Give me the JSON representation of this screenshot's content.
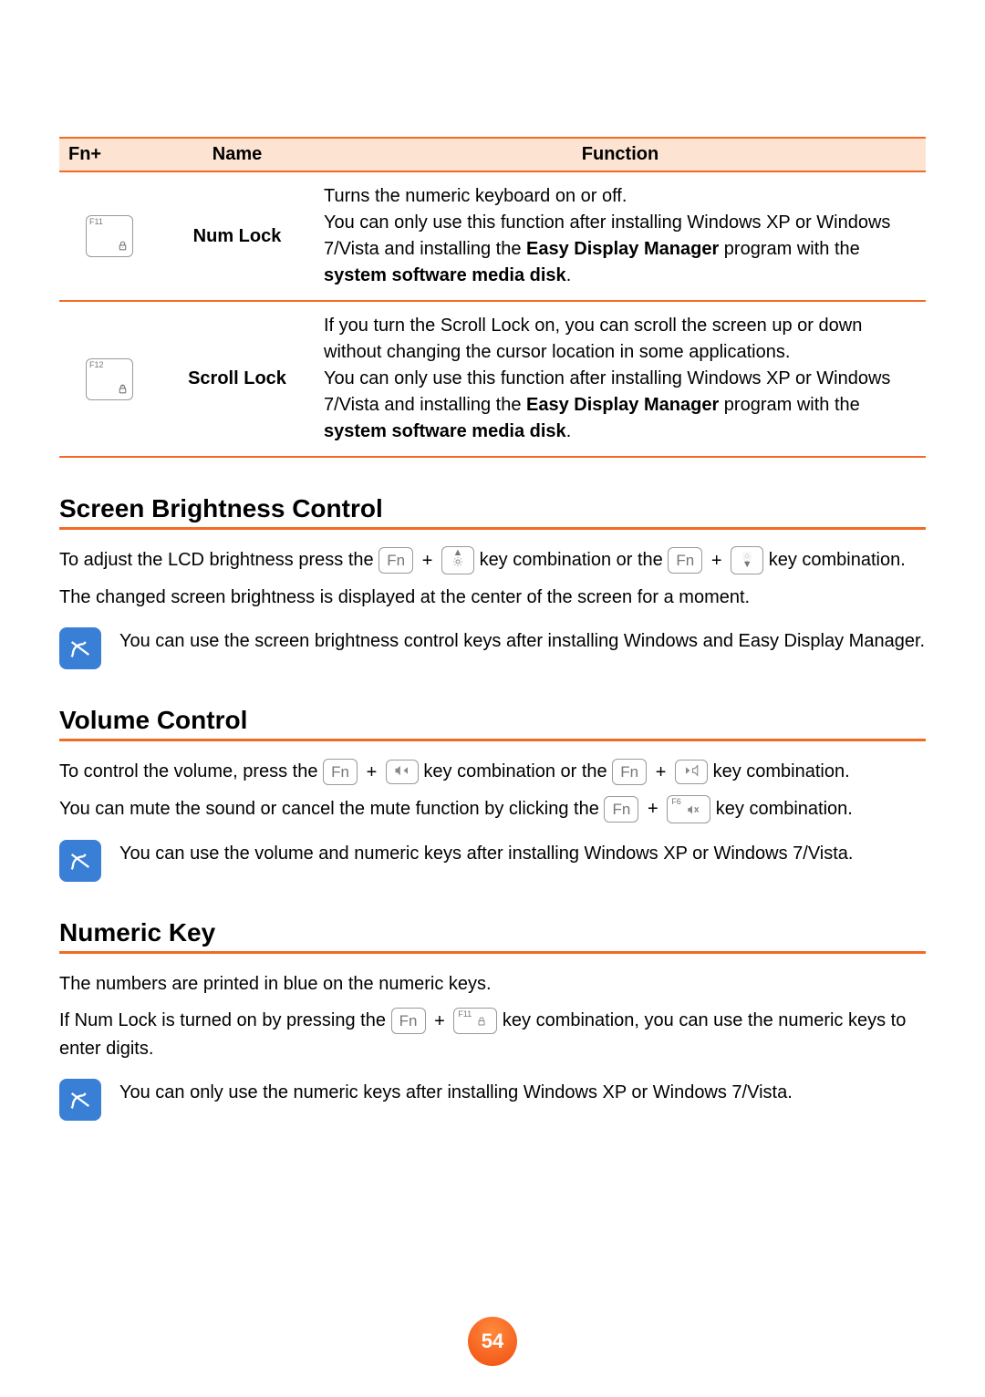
{
  "table": {
    "headers": [
      "Fn+",
      "Name",
      "Function"
    ],
    "rows": [
      {
        "key_label": "F11",
        "key_icon_name": "numlock-icon",
        "name": "Num Lock",
        "function_html": "Turns the numeric keyboard on or off.<br>You can only use this function after installing Windows XP or Windows 7/Vista and installing the <b>Easy Display Manager</b> program with the <b>system software media disk</b>."
      },
      {
        "key_label": "F12",
        "key_icon_name": "scrolllock-icon",
        "name": "Scroll Lock",
        "function_html": "If you turn the Scroll Lock on, you can scroll the screen up or down without changing the cursor location in some applications.<br>You can only use this function after installing Windows XP or Windows 7/Vista and installing the <b>Easy Display Manager</b> program with the <b>system software media disk</b>."
      }
    ]
  },
  "sections": {
    "brightness": {
      "title": "Screen Brightness Control",
      "line1_pre": "To adjust the LCD brightness press the ",
      "key_fn": "Fn",
      "line1_mid": " key combination or the ",
      "line1_post": " key combination.",
      "line2": "The changed screen brightness is displayed at the center of the screen for a moment.",
      "note": "You can use the screen brightness control keys after installing Windows and Easy Display Manager."
    },
    "volume": {
      "title": "Volume Control",
      "line1_pre": "To control the volume, press the ",
      "key_fn": "Fn",
      "line1_mid": " key combination or the ",
      "line1_post": " key combination.",
      "line2_pre": "You can mute the sound or cancel the mute function by clicking the ",
      "line2_post": " key combination.",
      "mute_key_label": "F6",
      "note": "You can use the volume and numeric keys after installing Windows XP or Windows 7/Vista."
    },
    "numeric": {
      "title": "Numeric Key",
      "line1": "The numbers are printed in blue on the numeric keys.",
      "line2_pre": "If Num Lock is turned on by pressing the ",
      "key_fn": "Fn",
      "f11_label": "F11",
      "line2_post": " key combination, you can use the numeric keys to enter digits.",
      "note": "You can only use the numeric keys after installing Windows XP or Windows 7/Vista."
    }
  },
  "page_number": "54",
  "glyphs": {
    "plus": "+"
  }
}
